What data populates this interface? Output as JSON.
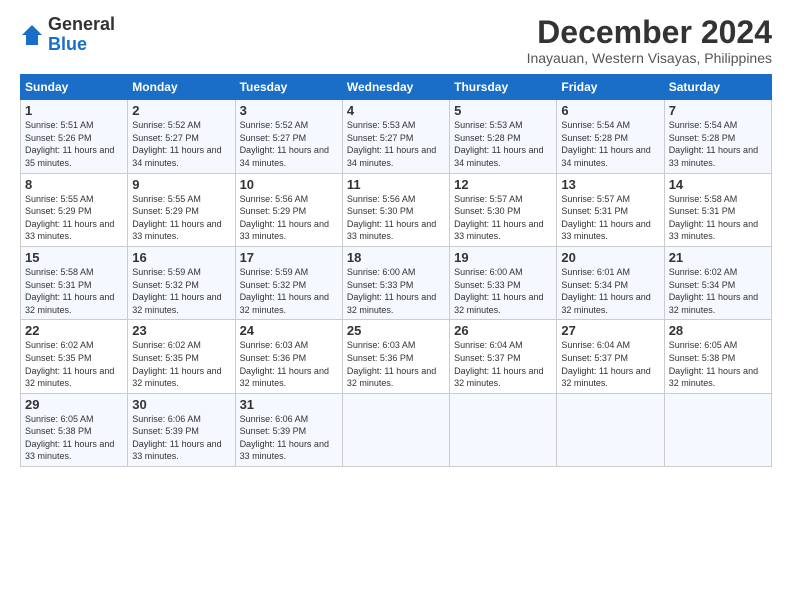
{
  "logo": {
    "general": "General",
    "blue": "Blue"
  },
  "title": "December 2024",
  "subtitle": "Inayauan, Western Visayas, Philippines",
  "headers": [
    "Sunday",
    "Monday",
    "Tuesday",
    "Wednesday",
    "Thursday",
    "Friday",
    "Saturday"
  ],
  "weeks": [
    [
      {
        "day": "1",
        "sunrise": "Sunrise: 5:51 AM",
        "sunset": "Sunset: 5:26 PM",
        "daylight": "Daylight: 11 hours and 35 minutes."
      },
      {
        "day": "2",
        "sunrise": "Sunrise: 5:52 AM",
        "sunset": "Sunset: 5:27 PM",
        "daylight": "Daylight: 11 hours and 34 minutes."
      },
      {
        "day": "3",
        "sunrise": "Sunrise: 5:52 AM",
        "sunset": "Sunset: 5:27 PM",
        "daylight": "Daylight: 11 hours and 34 minutes."
      },
      {
        "day": "4",
        "sunrise": "Sunrise: 5:53 AM",
        "sunset": "Sunset: 5:27 PM",
        "daylight": "Daylight: 11 hours and 34 minutes."
      },
      {
        "day": "5",
        "sunrise": "Sunrise: 5:53 AM",
        "sunset": "Sunset: 5:28 PM",
        "daylight": "Daylight: 11 hours and 34 minutes."
      },
      {
        "day": "6",
        "sunrise": "Sunrise: 5:54 AM",
        "sunset": "Sunset: 5:28 PM",
        "daylight": "Daylight: 11 hours and 34 minutes."
      },
      {
        "day": "7",
        "sunrise": "Sunrise: 5:54 AM",
        "sunset": "Sunset: 5:28 PM",
        "daylight": "Daylight: 11 hours and 33 minutes."
      }
    ],
    [
      {
        "day": "8",
        "sunrise": "Sunrise: 5:55 AM",
        "sunset": "Sunset: 5:29 PM",
        "daylight": "Daylight: 11 hours and 33 minutes."
      },
      {
        "day": "9",
        "sunrise": "Sunrise: 5:55 AM",
        "sunset": "Sunset: 5:29 PM",
        "daylight": "Daylight: 11 hours and 33 minutes."
      },
      {
        "day": "10",
        "sunrise": "Sunrise: 5:56 AM",
        "sunset": "Sunset: 5:29 PM",
        "daylight": "Daylight: 11 hours and 33 minutes."
      },
      {
        "day": "11",
        "sunrise": "Sunrise: 5:56 AM",
        "sunset": "Sunset: 5:30 PM",
        "daylight": "Daylight: 11 hours and 33 minutes."
      },
      {
        "day": "12",
        "sunrise": "Sunrise: 5:57 AM",
        "sunset": "Sunset: 5:30 PM",
        "daylight": "Daylight: 11 hours and 33 minutes."
      },
      {
        "day": "13",
        "sunrise": "Sunrise: 5:57 AM",
        "sunset": "Sunset: 5:31 PM",
        "daylight": "Daylight: 11 hours and 33 minutes."
      },
      {
        "day": "14",
        "sunrise": "Sunrise: 5:58 AM",
        "sunset": "Sunset: 5:31 PM",
        "daylight": "Daylight: 11 hours and 33 minutes."
      }
    ],
    [
      {
        "day": "15",
        "sunrise": "Sunrise: 5:58 AM",
        "sunset": "Sunset: 5:31 PM",
        "daylight": "Daylight: 11 hours and 32 minutes."
      },
      {
        "day": "16",
        "sunrise": "Sunrise: 5:59 AM",
        "sunset": "Sunset: 5:32 PM",
        "daylight": "Daylight: 11 hours and 32 minutes."
      },
      {
        "day": "17",
        "sunrise": "Sunrise: 5:59 AM",
        "sunset": "Sunset: 5:32 PM",
        "daylight": "Daylight: 11 hours and 32 minutes."
      },
      {
        "day": "18",
        "sunrise": "Sunrise: 6:00 AM",
        "sunset": "Sunset: 5:33 PM",
        "daylight": "Daylight: 11 hours and 32 minutes."
      },
      {
        "day": "19",
        "sunrise": "Sunrise: 6:00 AM",
        "sunset": "Sunset: 5:33 PM",
        "daylight": "Daylight: 11 hours and 32 minutes."
      },
      {
        "day": "20",
        "sunrise": "Sunrise: 6:01 AM",
        "sunset": "Sunset: 5:34 PM",
        "daylight": "Daylight: 11 hours and 32 minutes."
      },
      {
        "day": "21",
        "sunrise": "Sunrise: 6:02 AM",
        "sunset": "Sunset: 5:34 PM",
        "daylight": "Daylight: 11 hours and 32 minutes."
      }
    ],
    [
      {
        "day": "22",
        "sunrise": "Sunrise: 6:02 AM",
        "sunset": "Sunset: 5:35 PM",
        "daylight": "Daylight: 11 hours and 32 minutes."
      },
      {
        "day": "23",
        "sunrise": "Sunrise: 6:02 AM",
        "sunset": "Sunset: 5:35 PM",
        "daylight": "Daylight: 11 hours and 32 minutes."
      },
      {
        "day": "24",
        "sunrise": "Sunrise: 6:03 AM",
        "sunset": "Sunset: 5:36 PM",
        "daylight": "Daylight: 11 hours and 32 minutes."
      },
      {
        "day": "25",
        "sunrise": "Sunrise: 6:03 AM",
        "sunset": "Sunset: 5:36 PM",
        "daylight": "Daylight: 11 hours and 32 minutes."
      },
      {
        "day": "26",
        "sunrise": "Sunrise: 6:04 AM",
        "sunset": "Sunset: 5:37 PM",
        "daylight": "Daylight: 11 hours and 32 minutes."
      },
      {
        "day": "27",
        "sunrise": "Sunrise: 6:04 AM",
        "sunset": "Sunset: 5:37 PM",
        "daylight": "Daylight: 11 hours and 32 minutes."
      },
      {
        "day": "28",
        "sunrise": "Sunrise: 6:05 AM",
        "sunset": "Sunset: 5:38 PM",
        "daylight": "Daylight: 11 hours and 32 minutes."
      }
    ],
    [
      {
        "day": "29",
        "sunrise": "Sunrise: 6:05 AM",
        "sunset": "Sunset: 5:38 PM",
        "daylight": "Daylight: 11 hours and 33 minutes."
      },
      {
        "day": "30",
        "sunrise": "Sunrise: 6:06 AM",
        "sunset": "Sunset: 5:39 PM",
        "daylight": "Daylight: 11 hours and 33 minutes."
      },
      {
        "day": "31",
        "sunrise": "Sunrise: 6:06 AM",
        "sunset": "Sunset: 5:39 PM",
        "daylight": "Daylight: 11 hours and 33 minutes."
      },
      null,
      null,
      null,
      null
    ]
  ]
}
